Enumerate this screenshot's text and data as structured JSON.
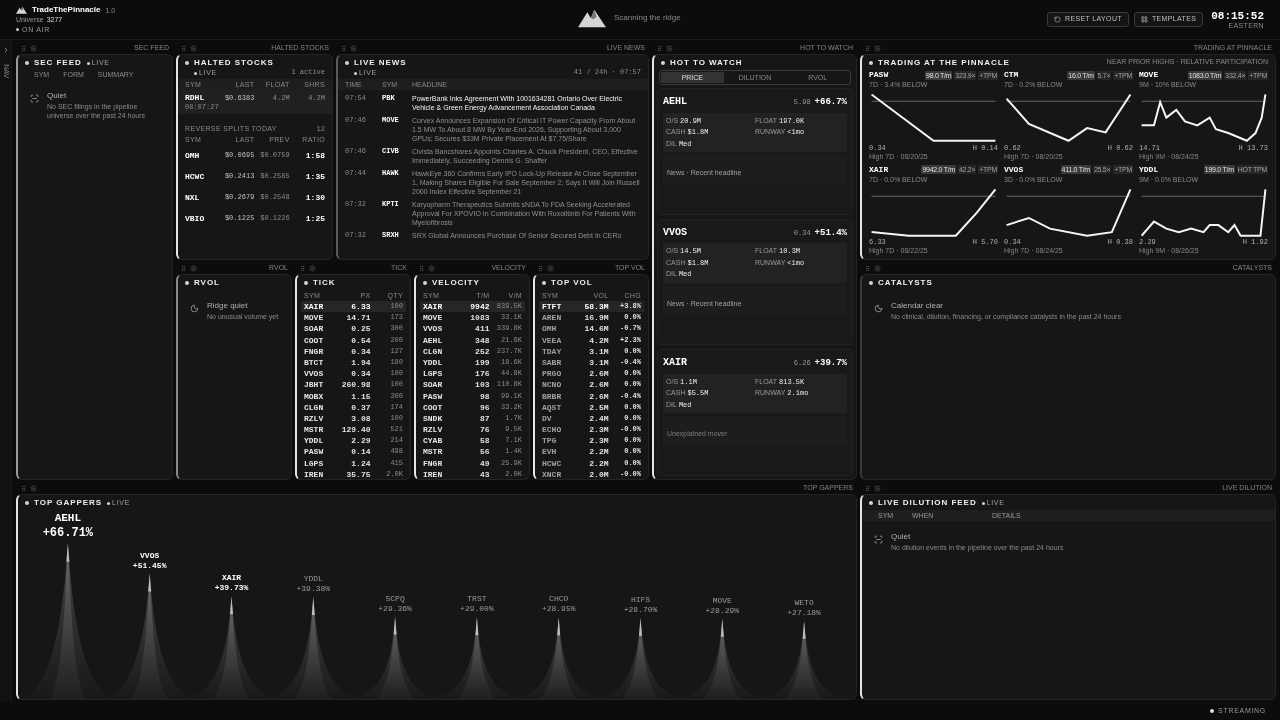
{
  "topbar": {
    "brand": "TradeThePinnacle",
    "version": "1.0",
    "universe_label": "Universe",
    "universe_count": "3277",
    "status": "ON AIR",
    "tagline": "Scanning the ridge",
    "buttons": [
      {
        "label": "RESET LAYOUT",
        "kind": "reset"
      },
      {
        "label": "TEMPLATES",
        "kind": "templates"
      }
    ],
    "clock": "08:15:52",
    "timezone": "EASTERN"
  },
  "nav": {
    "label": "NAV"
  },
  "sec_feed": {
    "handle": "SEC FEED",
    "title": "SEC FEED",
    "live": "LIVE",
    "columns": [
      "SYM",
      "FORM",
      "SUMMARY"
    ],
    "empty_title": "Quiet",
    "empty_text": "No SEC filings in the pipeline universe over the past 24 hours"
  },
  "halted": {
    "handle": "HALTED STOCKS",
    "title": "HALTED STOCKS",
    "live": "LIVE",
    "count": "1 active",
    "columns": [
      "SYM",
      "LAST",
      "FLOAT",
      "SHRS"
    ],
    "rows": [
      {
        "cells": [
          "RDHL",
          "$0.6383",
          "4.2M",
          "4.2M"
        ],
        "time": "08:07:27"
      }
    ],
    "splits_title": "REVERSE SPLITS TODAY",
    "splits_count": "12",
    "split_columns": [
      "SYM",
      "LAST",
      "PREV",
      "RATIO"
    ],
    "splits": [
      [
        "OMH",
        "$0.0695",
        "$0.0759",
        "1:58"
      ],
      [
        "HCWC",
        "$0.2413",
        "$0.2585",
        "1:35"
      ],
      [
        "NXL",
        "$0.2679",
        "$0.2548",
        "1:30"
      ],
      [
        "VBIO",
        "$0.1225",
        "$0.1226",
        "1:25"
      ]
    ]
  },
  "news": {
    "handle": "LIVE NEWS",
    "title": "LIVE NEWS",
    "live": "LIVE",
    "meta": "41 / 24h · 07:57",
    "columns": [
      "TIME",
      "SYM",
      "HEADLINE"
    ],
    "rows": [
      {
        "time": "07:54",
        "sym": "PBK",
        "headline": "PowerBank Inks Agreement With 1001634281 Ontario Over Electric Vehicle & Green Energy Advancement Association Canada",
        "unread": true
      },
      {
        "time": "07:46",
        "sym": "MOVE",
        "headline": "Corvex Announces Expansion Of Critical IT Power Capacity From About 1.5 MW To About 8 MW By Year-End 2026, Supporting About 3,000 GPUs; Secures $33M Private Placement At $7.75/Share",
        "unread": false
      },
      {
        "time": "07:46",
        "sym": "CIVB",
        "headline": "Civista Bancshares Appoints Charles A. Chuck President, CEO, Effective Immediately, Succeeding Dennis G. Shaffer",
        "unread": false
      },
      {
        "time": "07:44",
        "sym": "HAWK",
        "headline": "HawkEye 360 Confirms Early IPO Lock-Up Release At Close September 1, Making Shares Eligible For Sale September 2; Says It Will Join Russell 2000 Index Effective September 21",
        "unread": false
      },
      {
        "time": "07:32",
        "sym": "KPTI",
        "headline": "Karyopharm Therapeutics Submits sNDA To FDA Seeking Accelerated Approval For XPOVIO In Combination With Ruxolitinib For Patients With Myelofibrosis",
        "unread": false
      },
      {
        "time": "07:32",
        "sym": "SRXH",
        "headline": "SRX Global Announces Purchase Of Senior Secured Debt In CERo",
        "unread": false
      }
    ]
  },
  "hot": {
    "handle": "HOT TO WATCH",
    "title": "HOT TO WATCH",
    "tabs": [
      {
        "label": "PRICE",
        "selected": true
      },
      {
        "label": "DILUTION",
        "selected": false
      },
      {
        "label": "RVOL",
        "selected": false
      }
    ],
    "cards": [
      {
        "sym": "AEHL",
        "price": "5.98",
        "change": "+66.7%",
        "stats": [
          {
            "label": "O/S",
            "value": "20.9M"
          },
          {
            "label": "FLOAT",
            "value": "197.0K"
          },
          {
            "label": "CASH",
            "value": "$1.8M"
          },
          {
            "label": "RUNWAY",
            "value": "<1mo"
          },
          {
            "label": "DIL",
            "value": "Med"
          }
        ],
        "note": "News · Recent headline",
        "kind": "news"
      },
      {
        "sym": "VVOS",
        "price": "0.34",
        "change": "+51.4%",
        "stats": [
          {
            "label": "O/S",
            "value": "14.5M"
          },
          {
            "label": "FLOAT",
            "value": "10.3M"
          },
          {
            "label": "CASH",
            "value": "$1.8M"
          },
          {
            "label": "RUNWAY",
            "value": "<1mo"
          },
          {
            "label": "DIL",
            "value": "Med"
          }
        ],
        "note": "News · Recent headline",
        "kind": "news"
      },
      {
        "sym": "XAIR",
        "price": "6.26",
        "change": "+39.7%",
        "stats": [
          {
            "label": "O/S",
            "value": "1.1M"
          },
          {
            "label": "FLOAT",
            "value": "813.5K"
          },
          {
            "label": "CASH",
            "value": "$5.5M"
          },
          {
            "label": "RUNWAY",
            "value": "2.1mo"
          },
          {
            "label": "DIL",
            "value": "Med"
          }
        ],
        "note": "Unexplained mover",
        "kind": "unexplained"
      }
    ]
  },
  "pinnacle": {
    "handle": "TRADING AT PINNACLE",
    "title": "TRADING AT THE PINNACLE",
    "subtitle": "NEAR PRIOR HIGHS · RELATIVE PARTICIPATION",
    "cards": [
      {
        "sym": "PASW",
        "badges": [
          "98.0 T/m",
          "323.9×",
          "+TPM"
        ],
        "sub": "7D · 3.4% BELOW",
        "last": "0.34",
        "high": "H 0.14",
        "date": "High 7D · 08/20/25"
      },
      {
        "sym": "CTM",
        "badges": [
          "16.0 T/m",
          "5.7×",
          "+TPM"
        ],
        "sub": "7D · 0.2% BELOW",
        "last": "0.62",
        "high": "H 0.62",
        "date": "High 7D · 08/20/25"
      },
      {
        "sym": "MOVE",
        "badges": [
          "1083.0 T/m",
          "332.4×",
          "+TPM"
        ],
        "sub": "9M · 10% BELOW",
        "last": "14.71",
        "high": "H 13.73",
        "date": "High 9M · 08/24/25"
      },
      {
        "sym": "XAIR",
        "badges": [
          "9942.0 T/m",
          "42.2×",
          "+TPM"
        ],
        "sub": "7D · 0.0% BELOW",
        "last": "6.33",
        "high": "H 5.70",
        "date": "High 7D · 08/22/25"
      },
      {
        "sym": "VVOS",
        "badges": [
          "411.0 T/m",
          "25.5×",
          "+TPM"
        ],
        "sub": "3D · 0.0% BELOW",
        "last": "0.34",
        "high": "H 0.38",
        "date": "High 7D · 08/24/25"
      },
      {
        "sym": "YDDL",
        "badges": [
          "199.0 T/m",
          "HOT TPM"
        ],
        "sub": "9M · 0.0% BELOW",
        "last": "2.29",
        "high": "H 1.92",
        "date": "High 9M · 08/26/25"
      }
    ]
  },
  "rvol": {
    "handle": "RVOL",
    "title": "RVOL",
    "empty_title": "Ridge quiet",
    "empty_text": "No unusual volume yet"
  },
  "tick": {
    "handle": "TICK",
    "title": "TICK",
    "columns": [
      "SYM",
      "PX",
      "QTY"
    ],
    "rows": [
      {
        "cells": [
          "XAIR",
          "6.33",
          "100"
        ],
        "highlight": true
      },
      {
        "cells": [
          "MOVE",
          "14.71",
          "173"
        ],
        "highlight": false
      },
      {
        "cells": [
          "SOAR",
          "0.25",
          "300"
        ],
        "highlight": false
      },
      {
        "cells": [
          "COOT",
          "0.54",
          "200"
        ],
        "highlight": false
      },
      {
        "cells": [
          "FNGR",
          "0.34",
          "127"
        ],
        "highlight": false
      },
      {
        "cells": [
          "BTCT",
          "1.94",
          "180"
        ],
        "highlight": false
      },
      {
        "cells": [
          "VVOS",
          "0.34",
          "100"
        ],
        "highlight": false
      },
      {
        "cells": [
          "JBHT",
          "260.98",
          "100"
        ],
        "highlight": false
      },
      {
        "cells": [
          "MOBX",
          "1.15",
          "300"
        ],
        "highlight": false
      },
      {
        "cells": [
          "CLGN",
          "0.37",
          "174"
        ],
        "highlight": false
      },
      {
        "cells": [
          "RZLV",
          "3.08",
          "100"
        ],
        "highlight": false
      },
      {
        "cells": [
          "MSTR",
          "129.40",
          "521"
        ],
        "highlight": false
      },
      {
        "cells": [
          "YDDL",
          "2.29",
          "214"
        ],
        "highlight": false
      },
      {
        "cells": [
          "PASW",
          "0.14",
          "498"
        ],
        "highlight": false
      },
      {
        "cells": [
          "LGPS",
          "1.24",
          "415"
        ],
        "highlight": false
      },
      {
        "cells": [
          "IREN",
          "35.75",
          "2.0K"
        ],
        "highlight": false
      }
    ]
  },
  "velocity": {
    "handle": "VELOCITY",
    "title": "VELOCITY",
    "columns": [
      "SYM",
      "T/M",
      "V/M"
    ],
    "rows": [
      {
        "cells": [
          "XAIR",
          "9942",
          "839.5K"
        ],
        "highlight": true
      },
      {
        "cells": [
          "MOVE",
          "1083",
          "33.1K"
        ],
        "highlight": false
      },
      {
        "cells": [
          "VVOS",
          "411",
          "339.8K"
        ],
        "highlight": false
      },
      {
        "cells": [
          "AEHL",
          "348",
          "21.6K"
        ],
        "highlight": false
      },
      {
        "cells": [
          "CLGN",
          "252",
          "237.7K"
        ],
        "highlight": false
      },
      {
        "cells": [
          "YDDL",
          "199",
          "18.6K"
        ],
        "highlight": false
      },
      {
        "cells": [
          "LGPS",
          "176",
          "44.8K"
        ],
        "highlight": false
      },
      {
        "cells": [
          "SOAR",
          "103",
          "110.8K"
        ],
        "highlight": false
      },
      {
        "cells": [
          "PASW",
          "98",
          "99.1K"
        ],
        "highlight": false
      },
      {
        "cells": [
          "COOT",
          "96",
          "33.2K"
        ],
        "highlight": false
      },
      {
        "cells": [
          "SNDK",
          "87",
          "1.7K"
        ],
        "highlight": false
      },
      {
        "cells": [
          "RZLV",
          "76",
          "9.5K"
        ],
        "highlight": false
      },
      {
        "cells": [
          "CYAB",
          "58",
          "7.1K"
        ],
        "highlight": false
      },
      {
        "cells": [
          "MSTR",
          "56",
          "1.4K"
        ],
        "highlight": false
      },
      {
        "cells": [
          "FNGR",
          "49",
          "25.9K"
        ],
        "highlight": false
      },
      {
        "cells": [
          "IREN",
          "43",
          "2.0K"
        ],
        "highlight": false
      }
    ]
  },
  "topvol": {
    "handle": "TOP VOL",
    "title": "TOP VOL",
    "columns": [
      "SYM",
      "VOL",
      "CHG"
    ],
    "rows": [
      {
        "cells": [
          "FTFT",
          "58.3M",
          "+3.8%"
        ],
        "highlight": true
      },
      {
        "cells": [
          "AREN",
          "16.9M",
          "0.0%"
        ],
        "highlight": false
      },
      {
        "cells": [
          "OMH",
          "14.6M",
          "-0.7%"
        ],
        "highlight": false
      },
      {
        "cells": [
          "VEEA",
          "4.2M",
          "+2.3%"
        ],
        "highlight": false
      },
      {
        "cells": [
          "TDAY",
          "3.1M",
          "0.0%"
        ],
        "highlight": false
      },
      {
        "cells": [
          "SABR",
          "3.1M",
          "-0.4%"
        ],
        "highlight": false
      },
      {
        "cells": [
          "PRGO",
          "2.6M",
          "0.0%"
        ],
        "highlight": false
      },
      {
        "cells": [
          "NCNO",
          "2.6M",
          "0.0%"
        ],
        "highlight": false
      },
      {
        "cells": [
          "BRBR",
          "2.6M",
          "-0.4%"
        ],
        "highlight": false
      },
      {
        "cells": [
          "AQST",
          "2.5M",
          "0.0%"
        ],
        "highlight": false
      },
      {
        "cells": [
          "DV",
          "2.4M",
          "0.0%"
        ],
        "highlight": false
      },
      {
        "cells": [
          "ECHO",
          "2.3M",
          "-0.0%"
        ],
        "highlight": false
      },
      {
        "cells": [
          "TPG",
          "2.3M",
          "0.0%"
        ],
        "highlight": false
      },
      {
        "cells": [
          "EVH",
          "2.2M",
          "0.0%"
        ],
        "highlight": false
      },
      {
        "cells": [
          "HCWC",
          "2.2M",
          "0.0%"
        ],
        "highlight": false
      },
      {
        "cells": [
          "XNCR",
          "2.0M",
          "-0.0%"
        ],
        "highlight": false
      }
    ]
  },
  "catalysts": {
    "handle": "CATALYSTS",
    "title": "CATALYSTS",
    "empty_title": "Calendar clear",
    "empty_text": "No clinical, dilution, financing, or compliance catalysts in the past 24 hours"
  },
  "gappers": {
    "handle": "TOP GAPPERS",
    "title": "TOP GAPPERS",
    "live": "LIVE",
    "items": [
      {
        "sym": "AEHL",
        "change": "+66.71%",
        "highlight": true
      },
      {
        "sym": "VVOS",
        "change": "+51.45%",
        "highlight": true
      },
      {
        "sym": "XAIR",
        "change": "+39.73%",
        "highlight": true
      },
      {
        "sym": "YDDL",
        "change": "+39.38%",
        "highlight": false
      },
      {
        "sym": "SCPQ",
        "change": "+29.36%",
        "highlight": false
      },
      {
        "sym": "TRST",
        "change": "+29.00%",
        "highlight": false
      },
      {
        "sym": "CHCO",
        "change": "+28.95%",
        "highlight": false
      },
      {
        "sym": "HIFS",
        "change": "+28.70%",
        "highlight": false
      },
      {
        "sym": "MOVE",
        "change": "+28.29%",
        "highlight": false
      },
      {
        "sym": "WETO",
        "change": "+27.18%",
        "highlight": false
      }
    ]
  },
  "dilution": {
    "handle": "LIVE DILUTION",
    "title": "LIVE DILUTION FEED",
    "live": "LIVE",
    "columns": [
      "SYM",
      "WHEN",
      "DETAILS"
    ],
    "empty_title": "Quiet",
    "empty_text": "No dilution events in the pipeline over the past 24 hours"
  },
  "status_bar": {
    "label": "STREAMING"
  }
}
